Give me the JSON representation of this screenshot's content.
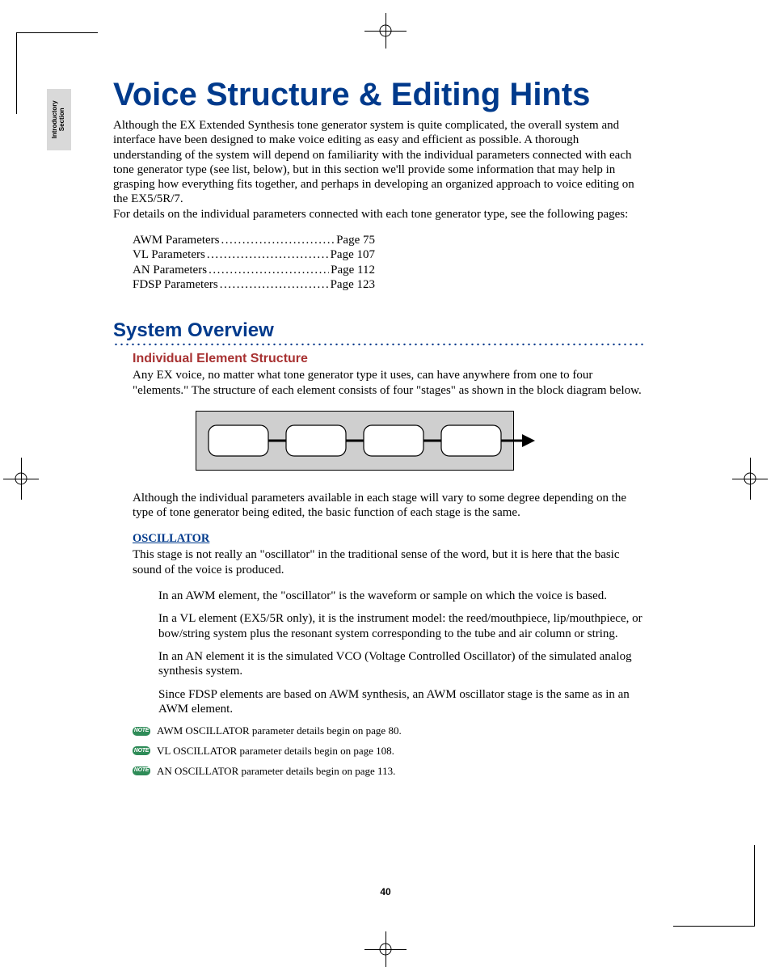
{
  "side_tab": {
    "line1": "Introductory",
    "line2": "Section"
  },
  "title": "Voice Structure & Editing Hints",
  "intro": "Although the EX Extended Synthesis tone generator system is quite complicated, the overall system and interface have been designed to make voice editing as easy and efficient as possible. A thorough understanding of the system will depend on familiarity with the individual parameters connected with each tone generator type (see list, below), but in this section we'll provide some information that may help in grasping how everything fits together, and perhaps in developing an organized approach to voice editing on the EX5/5R/7.",
  "intro2": "For details on the individual parameters connected with each tone generator type, see the following pages:",
  "params": [
    {
      "label": "AWM Parameters ",
      "page": "Page 75"
    },
    {
      "label": "VL Parameters ",
      "page": "Page 107"
    },
    {
      "label": "AN Parameters ",
      "page": "Page 112"
    },
    {
      "label": "FDSP Parameters",
      "page": "Page 123"
    }
  ],
  "section_head": "System Overview",
  "sub_head": "Individual Element Structure",
  "elem_para": "Any EX voice, no matter what tone generator type it uses, can have anywhere from one to four \"elements.\" The structure of each element consists of four \"stages\" as shown in the block diagram below.",
  "although_para": "Although the individual parameters available in each stage will vary to some degree depending on the type of tone generator being edited, the basic function of each stage is the same.",
  "osc_head": "OSCILLATOR",
  "osc_para": "This stage is not really an \"oscillator\" in the traditional sense of the word, but it is here that the basic sound of the voice is produced.",
  "bullets": [
    "In an AWM element, the \"oscillator\" is the waveform or sample on which the voice is based.",
    "In a VL element (EX5/5R only), it is the instrument model: the reed/mouthpiece, lip/mouthpiece, or bow/string system plus the resonant system corresponding to the tube and air column or string.",
    "In an AN element it is the simulated VCO (Voltage Controlled Oscillator) of the simulated analog synthesis system.",
    "Since FDSP elements are based on AWM synthesis, an AWM oscillator stage is the same as in an AWM element."
  ],
  "note_label": "NOTE",
  "notes": [
    "AWM OSCILLATOR parameter details begin on page 80.",
    "VL OSCILLATOR parameter details begin on page 108.",
    "AN OSCILLATOR parameter details begin on page 113."
  ],
  "page_number": "40",
  "dots": "............................",
  "dots_short": "................................",
  "dots_long": "..............................."
}
